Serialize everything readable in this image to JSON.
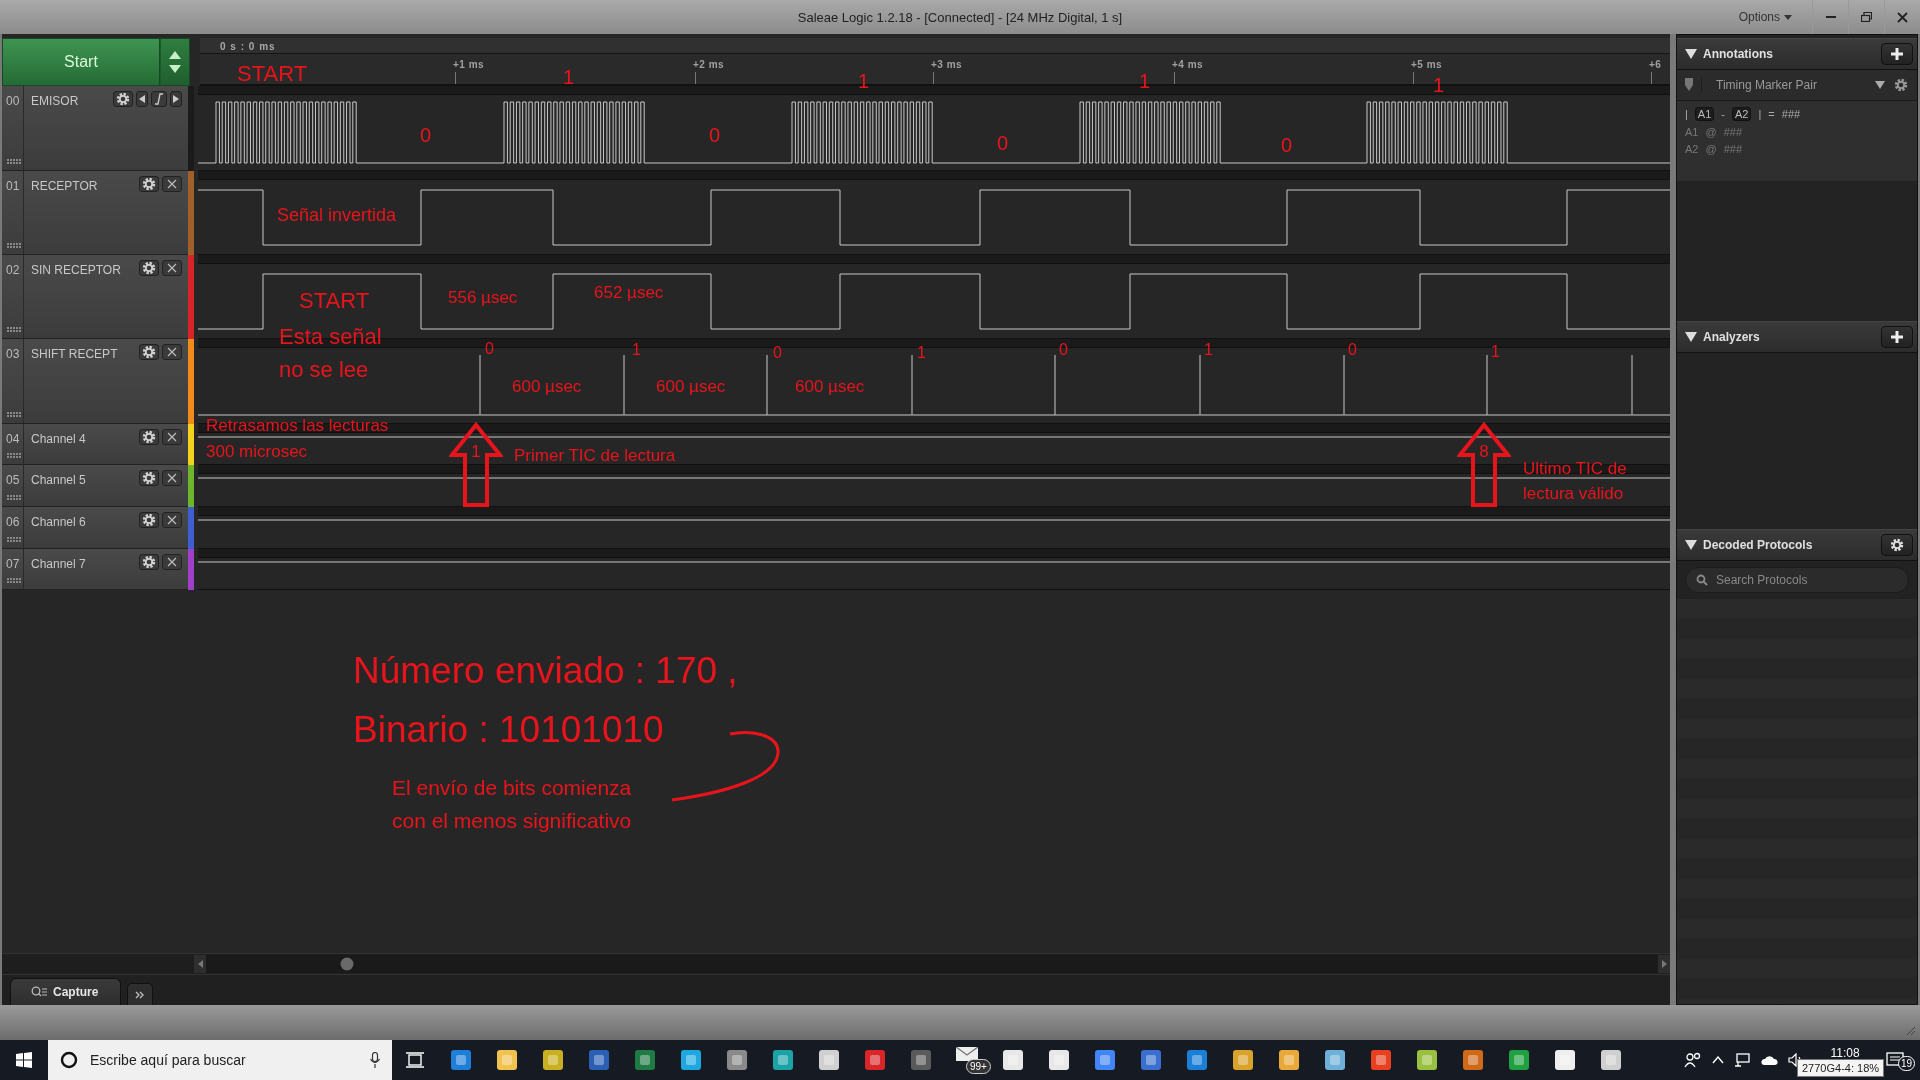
{
  "window": {
    "title": "Saleae Logic 1.2.18 - [Connected] - [24 MHz Digital, 1 s]",
    "options": "Options"
  },
  "start_button": "Start",
  "timeline": {
    "origin": "0 s : 0 ms",
    "ticks": [
      "+1 ms",
      "+2 ms",
      "+3 ms",
      "+4 ms",
      "+5 ms",
      "+6"
    ]
  },
  "channels": [
    {
      "number": "00",
      "name": "EMISOR",
      "kind": "trigger",
      "color": "#1b1b1b"
    },
    {
      "number": "01",
      "name": "RECEPTOR",
      "kind": "normal",
      "color": "#a0602a"
    },
    {
      "number": "02",
      "name": "SIN RECEPTOR",
      "kind": "normal",
      "color": "#d8232a"
    },
    {
      "number": "03",
      "name": "SHIFT RECEPT",
      "kind": "normal",
      "color": "#f08c1c"
    },
    {
      "number": "04",
      "name": "Channel 4",
      "kind": "normal",
      "color": "#f2d21c"
    },
    {
      "number": "05",
      "name": "Channel 5",
      "kind": "normal",
      "color": "#6cb52c"
    },
    {
      "number": "06",
      "name": "Channel 6",
      "kind": "normal",
      "color": "#3f5ecf"
    },
    {
      "number": "07",
      "name": "Channel 7",
      "kind": "normal",
      "color": "#a040c8"
    }
  ],
  "annotations": [
    {
      "text": "START"
    },
    {
      "text": "1"
    },
    {
      "text": "1"
    },
    {
      "text": "1"
    },
    {
      "text": "1"
    },
    {
      "text": "0"
    },
    {
      "text": "0"
    },
    {
      "text": "0"
    },
    {
      "text": "0"
    },
    {
      "text": "Señal invertida"
    },
    {
      "text": "START"
    },
    {
      "text": "Esta señal no se lee"
    },
    {
      "text": "556 µsec"
    },
    {
      "text": "652 µsec"
    },
    {
      "text": "0"
    },
    {
      "text": "1"
    },
    {
      "text": "0"
    },
    {
      "text": "1"
    },
    {
      "text": "0"
    },
    {
      "text": "1"
    },
    {
      "text": "0"
    },
    {
      "text": "1"
    },
    {
      "text": "600 µsec"
    },
    {
      "text": "600 µsec"
    },
    {
      "text": "600 µsec"
    },
    {
      "text": "Retrasamos las lecturas 300 microsec"
    },
    {
      "text": "Primer TIC de lectura"
    },
    {
      "text": "Ultimo TIC de lectura válido"
    },
    {
      "text": "Número enviado : 170 ,"
    },
    {
      "text": "Binario : 10101010"
    },
    {
      "text": "El envío de bits comienza con el menos significativo"
    }
  ],
  "arrows": [
    {
      "label": "1"
    },
    {
      "label": "8"
    }
  ],
  "capture_tab": "Capture",
  "side_panel": {
    "annotations": {
      "title": "Annotations",
      "expanded": true,
      "marker_pair": "Timing Marker Pair",
      "formula": [
        {
          "text": "|",
          "kind": "plain"
        },
        {
          "text": "A1",
          "kind": "box"
        },
        {
          "text": "-",
          "kind": "plain"
        },
        {
          "text": "A2",
          "kind": "box"
        },
        {
          "text": "|",
          "kind": "plain"
        },
        {
          "text": "=",
          "kind": "plain"
        },
        {
          "text": "###",
          "kind": "plain"
        }
      ],
      "markers": [
        {
          "name": "A1",
          "at": "@",
          "value": "###"
        },
        {
          "name": "A2",
          "at": "@",
          "value": "###"
        }
      ]
    },
    "analyzers": {
      "title": "Analyzers",
      "expanded": true
    },
    "decoded_protocols": {
      "title": "Decoded Protocols",
      "expanded": true,
      "search": {
        "placeholder": "Search Protocols"
      }
    }
  },
  "taskbar": {
    "search": {
      "placeholder": "Escribe aquí para buscar"
    },
    "mail_badge": "99+",
    "clock": "11:08",
    "notifications": "19",
    "tooltip": "2770G4-4: 18%"
  }
}
